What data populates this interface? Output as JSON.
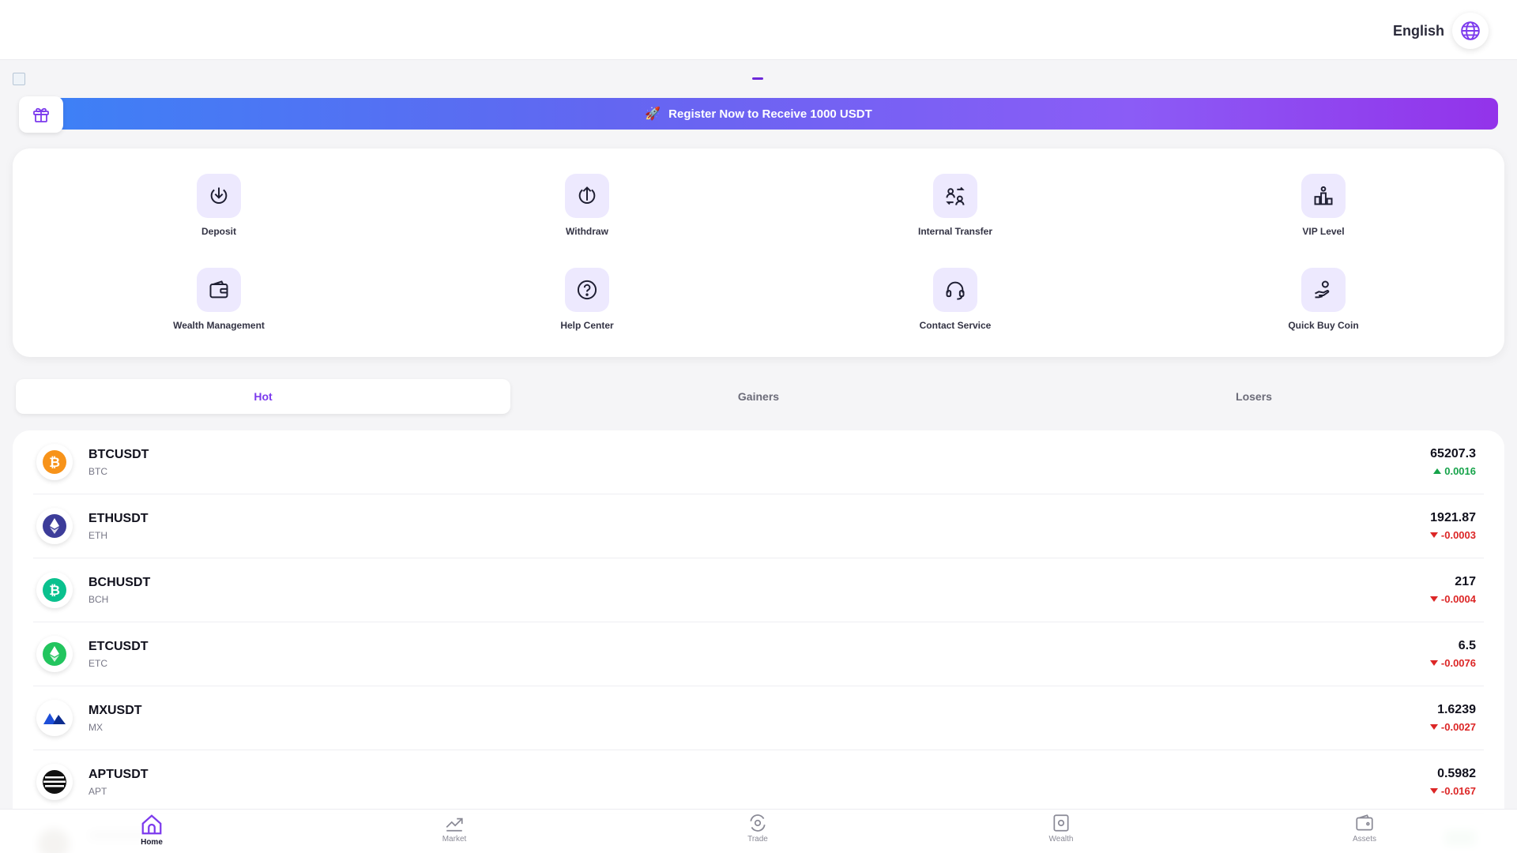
{
  "header": {
    "language": "English",
    "language_icon": "globe-icon"
  },
  "banner": {
    "text": "Register Now to Receive 1000 USDT",
    "emoji": "🚀",
    "gift_icon": "gift-icon"
  },
  "actions": [
    {
      "label": "Deposit",
      "icon": "deposit-icon"
    },
    {
      "label": "Withdraw",
      "icon": "withdraw-icon"
    },
    {
      "label": "Internal Transfer",
      "icon": "transfer-icon"
    },
    {
      "label": "VIP Level",
      "icon": "vip-icon"
    },
    {
      "label": "Wealth Management",
      "icon": "wallet-icon"
    },
    {
      "label": "Help Center",
      "icon": "help-icon"
    },
    {
      "label": "Contact Service",
      "icon": "headset-icon"
    },
    {
      "label": "Quick Buy Coin",
      "icon": "buy-coin-icon"
    }
  ],
  "tabs": [
    {
      "label": "Hot",
      "active": true
    },
    {
      "label": "Gainers",
      "active": false
    },
    {
      "label": "Losers",
      "active": false
    }
  ],
  "markets": [
    {
      "pair": "BTCUSDT",
      "symbol": "BTC",
      "price": "65207.3",
      "change": "0.0016",
      "direction": "up",
      "color": "#f7931a"
    },
    {
      "pair": "ETHUSDT",
      "symbol": "ETH",
      "price": "1921.87",
      "change": "-0.0003",
      "direction": "down",
      "color": "#3c3c99"
    },
    {
      "pair": "BCHUSDT",
      "symbol": "BCH",
      "price": "217",
      "change": "-0.0004",
      "direction": "down",
      "color": "#0ac18e"
    },
    {
      "pair": "ETCUSDT",
      "symbol": "ETC",
      "price": "6.5",
      "change": "-0.0076",
      "direction": "down",
      "color": "#22c55e"
    },
    {
      "pair": "MXUSDT",
      "symbol": "MX",
      "price": "1.6239",
      "change": "-0.0027",
      "direction": "down",
      "color": "#1d4ed8"
    },
    {
      "pair": "APTUSDT",
      "symbol": "APT",
      "price": "0.5982",
      "change": "-0.0167",
      "direction": "down",
      "color": "#111111"
    }
  ],
  "nav": [
    {
      "label": "Home",
      "icon": "home-icon",
      "active": true
    },
    {
      "label": "Market",
      "icon": "market-icon",
      "active": false
    },
    {
      "label": "Trade",
      "icon": "trade-icon",
      "active": false
    },
    {
      "label": "Wealth",
      "icon": "wealth-icon",
      "active": false
    },
    {
      "label": "Assets",
      "icon": "assets-icon",
      "active": false
    }
  ],
  "colors": {
    "accent": "#7c3aed",
    "up": "#16a34a",
    "down": "#dc2626"
  }
}
